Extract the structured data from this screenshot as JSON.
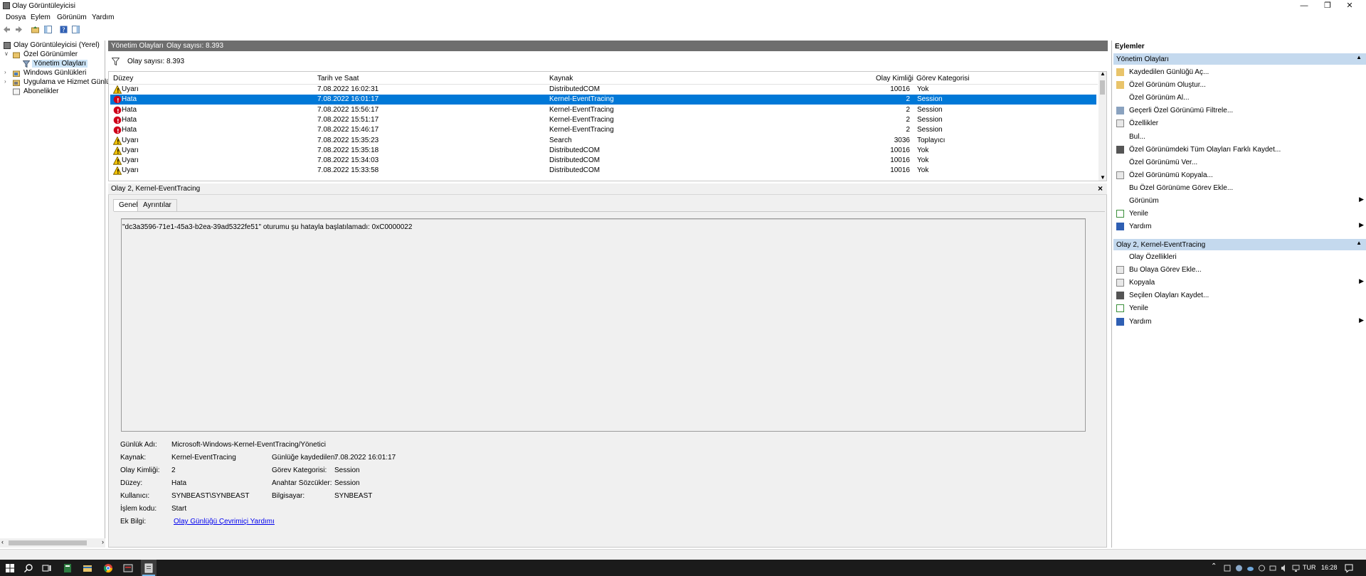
{
  "window": {
    "title": "Olay Görüntüleyicisi"
  },
  "menu": [
    "Dosya",
    "Eylem",
    "Görünüm",
    "Yardım"
  ],
  "tree": [
    {
      "label": "Olay Görüntüleyicisi (Yerel)"
    },
    {
      "label": "Özel Görünümler"
    },
    {
      "label": "Yönetim Olayları"
    },
    {
      "label": "Windows Günlükleri"
    },
    {
      "label": "Uygulama ve Hizmet Günlük"
    },
    {
      "label": "Abonelikler"
    }
  ],
  "center": {
    "title": "Yönetim Olayları",
    "count_label": "Olay sayısı: 8.393",
    "filter_label": "Olay sayısı: 8.393",
    "columns": [
      "Düzey",
      "Tarih ve Saat",
      "Kaynak",
      "Olay Kimliği",
      "Görev Kategorisi"
    ],
    "rows": [
      {
        "level": "Uyarı",
        "date": "7.08.2022 16:02:31",
        "source": "DistributedCOM",
        "id": "10016",
        "cat": "Yok"
      },
      {
        "level": "Hata",
        "date": "7.08.2022 16:01:17",
        "source": "Kernel-EventTracing",
        "id": "2",
        "cat": "Session"
      },
      {
        "level": "Hata",
        "date": "7.08.2022 15:56:17",
        "source": "Kernel-EventTracing",
        "id": "2",
        "cat": "Session"
      },
      {
        "level": "Hata",
        "date": "7.08.2022 15:51:17",
        "source": "Kernel-EventTracing",
        "id": "2",
        "cat": "Session"
      },
      {
        "level": "Hata",
        "date": "7.08.2022 15:46:17",
        "source": "Kernel-EventTracing",
        "id": "2",
        "cat": "Session"
      },
      {
        "level": "Uyarı",
        "date": "7.08.2022 15:35:23",
        "source": "Search",
        "id": "3036",
        "cat": "Toplayıcı"
      },
      {
        "level": "Uyarı",
        "date": "7.08.2022 15:35:18",
        "source": "DistributedCOM",
        "id": "10016",
        "cat": "Yok"
      },
      {
        "level": "Uyarı",
        "date": "7.08.2022 15:34:03",
        "source": "DistributedCOM",
        "id": "10016",
        "cat": "Yok"
      },
      {
        "level": "Uyarı",
        "date": "7.08.2022 15:33:58",
        "source": "DistributedCOM",
        "id": "10016",
        "cat": "Yok"
      }
    ]
  },
  "detail": {
    "title": "Olay 2, Kernel-EventTracing",
    "tabs": [
      "Genel",
      "Ayrıntılar"
    ],
    "message": "\"dc3a3596-71e1-45a3-b2ea-39ad5322fe51\" oturumu şu hatayla başlatılamadı: 0xC0000022",
    "fields": {
      "log_name_label": "Günlük Adı:",
      "log_name": "Microsoft-Windows-Kernel-EventTracing/Yönetici",
      "source_label": "Kaynak:",
      "source": "Kernel-EventTracing",
      "logged_label": "Günlüğe kaydedilen:",
      "logged": "7.08.2022 16:01:17",
      "event_id_label": "Olay Kimliği:",
      "event_id": "2",
      "task_label": "Görev Kategorisi:",
      "task": "Session",
      "level_label": "Düzey:",
      "level": "Hata",
      "keywords_label": "Anahtar Sözcükler:",
      "keywords": "Session",
      "user_label": "Kullanıcı:",
      "user": "SYNBEAST\\SYNBEAST",
      "computer_label": "Bilgisayar:",
      "computer": "SYNBEAST",
      "opcode_label": "İşlem kodu:",
      "opcode": "Start",
      "more_label": "Ek Bilgi:",
      "more_link": "Olay Günlüğü Çevrimiçi Yardımı"
    }
  },
  "actions": {
    "title": "Eylemler",
    "section1": "Yönetim Olayları",
    "items1": [
      "Kaydedilen Günlüğü Aç...",
      "Özel Görünüm Oluştur...",
      "Özel Görünüm Al...",
      "Geçerli Özel Görünümü Filtrele...",
      "Özellikler",
      "Bul...",
      "Özel Görünümdeki Tüm Olayları Farklı Kaydet...",
      "Özel Görünümü Ver...",
      "Özel Görünümü Kopyala...",
      "Bu Özel Görünüme Görev Ekle...",
      "Görünüm",
      "Yenile",
      "Yardım"
    ],
    "section2": "Olay 2, Kernel-EventTracing",
    "items2": [
      "Olay Özellikleri",
      "Bu Olaya Görev Ekle...",
      "Kopyala",
      "Seçilen Olayları Kaydet...",
      "Yenile",
      "Yardım"
    ]
  },
  "taskbar": {
    "lang": "TUR",
    "time": "16:28"
  },
  "colors": {
    "selection": "#0078d7",
    "warning": "#f5c400",
    "error": "#d0021b",
    "action_header": "#c4d9ee",
    "link": "#0000ee"
  }
}
